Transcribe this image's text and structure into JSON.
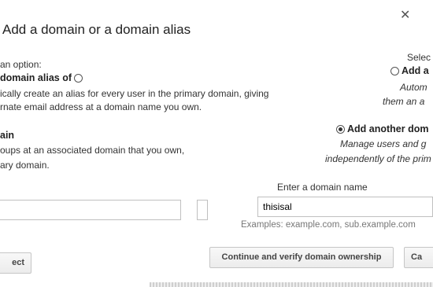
{
  "dialog": {
    "title": "Add a domain or a domain alias",
    "close_glyph": "✕"
  },
  "left": {
    "select_option": "an option:",
    "alias_option": {
      "label": "domain alias of",
      "desc_line1": "ically create an alias for every user in the primary domain, giving",
      "desc_line2": "rnate email address at a domain name you own."
    },
    "domain_option": {
      "label": "ain",
      "desc_line1": "oups at an associated domain that you own,",
      "desc_line2": "ary domain."
    },
    "input_value": ""
  },
  "right": {
    "select_option": "Selec",
    "alias_option": {
      "label": "Add a",
      "desc_line1": "Autom",
      "desc_line2": "them an a"
    },
    "domain_option": {
      "label": "Add another dom",
      "desc_line1": "Manage users and g",
      "desc_line2": "independently of the prim"
    },
    "domain_input": {
      "label": "Enter a domain name",
      "value": "thisisal"
    },
    "example_hint": "Examples: example.com, sub.example.com"
  },
  "buttons": {
    "left_cancel": "ect",
    "continue": "Continue and verify domain ownership",
    "right_cancel": "Ca"
  }
}
